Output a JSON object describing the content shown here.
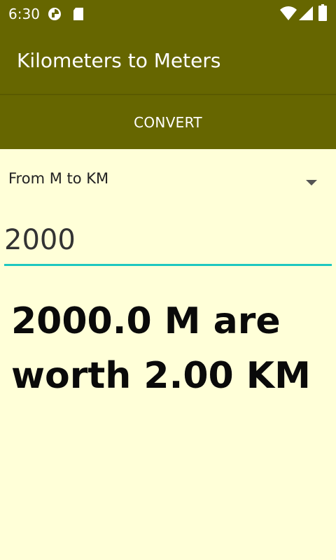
{
  "status_bar": {
    "time": "6:30",
    "icons": [
      "pinwheel-icon",
      "sd-card-icon",
      "wifi-icon",
      "cell-signal-icon",
      "battery-icon"
    ]
  },
  "app_bar": {
    "title": "Kilometers to Meters"
  },
  "toolbar": {
    "convert_label": "CONVERT"
  },
  "spinner": {
    "selected": "From M to KM"
  },
  "input": {
    "value": "2000"
  },
  "result": {
    "text": "2000.0 M are worth 2.00 KM"
  },
  "colors": {
    "primary": "#666600",
    "background": "#FFFFD8",
    "accent": "#1EC8C0"
  }
}
